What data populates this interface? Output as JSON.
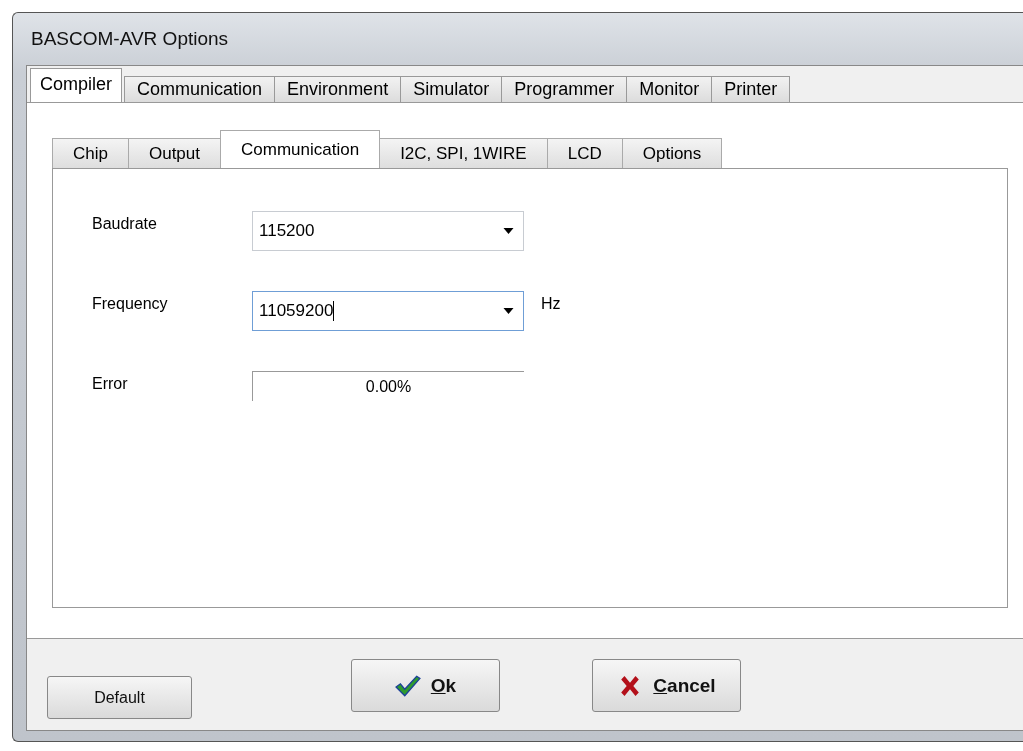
{
  "window": {
    "title": "BASCOM-AVR Options"
  },
  "tabs": [
    {
      "label": "Compiler",
      "selected": true
    },
    {
      "label": "Communication",
      "selected": false
    },
    {
      "label": "Environment",
      "selected": false
    },
    {
      "label": "Simulator",
      "selected": false
    },
    {
      "label": "Programmer",
      "selected": false
    },
    {
      "label": "Monitor",
      "selected": false
    },
    {
      "label": "Printer",
      "selected": false
    }
  ],
  "subtabs": [
    {
      "label": "Chip",
      "selected": false
    },
    {
      "label": "Output",
      "selected": false
    },
    {
      "label": "Communication",
      "selected": true
    },
    {
      "label": "I2C, SPI, 1WIRE",
      "selected": false
    },
    {
      "label": "LCD",
      "selected": false
    },
    {
      "label": "Options",
      "selected": false
    }
  ],
  "fields": [
    {
      "kind": "combo",
      "label": "Baudrate",
      "value": "115200",
      "focused": false
    },
    {
      "kind": "combo",
      "label": "Frequency",
      "value": "11059200",
      "focused": true,
      "unit": "Hz"
    },
    {
      "kind": "readout",
      "label": "Error",
      "value": "0.00%"
    }
  ],
  "buttons": [
    {
      "kind": "plain",
      "label": "Default",
      "accelerator": false
    },
    {
      "kind": "ok",
      "label": "Ok",
      "accelerator": true
    },
    {
      "kind": "cancel",
      "label": "Cancel",
      "accelerator": true
    }
  ]
}
